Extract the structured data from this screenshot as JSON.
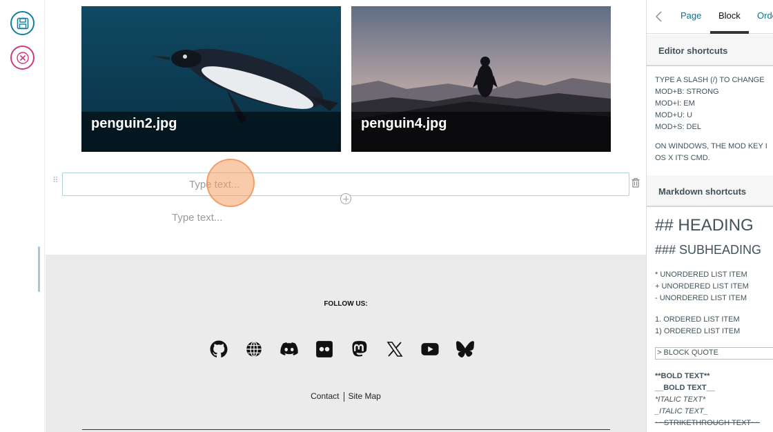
{
  "toolbar": {
    "save_icon": "save-icon",
    "cancel_icon": "close-icon"
  },
  "editor": {
    "images": [
      {
        "caption": "penguin2.jpg"
      },
      {
        "caption": "penguin4.jpg"
      }
    ],
    "text_block_placeholder": "Type text...",
    "next_block_placeholder": "Type text..."
  },
  "footer": {
    "follow_label": "FOLLOW US:",
    "socials": [
      "github-icon",
      "globe-icon",
      "discord-icon",
      "flickr-icon",
      "mastodon-icon",
      "x-icon",
      "youtube-icon",
      "bluesky-icon"
    ],
    "links": {
      "contact": "Contact",
      "sitemap": "Site Map"
    }
  },
  "sidebar": {
    "tabs": {
      "page": "Page",
      "block": "Block",
      "order": "Order"
    },
    "editor_shortcuts": {
      "title": "Editor shortcuts",
      "items": [
        "TYPE A SLASH (/) TO CHANGE",
        "MOD+B: STRONG",
        "MOD+I: EM",
        "MOD+U: U",
        "MOD+S: DEL"
      ],
      "note": [
        "ON WINDOWS, THE MOD KEY I",
        "OS X IT'S CMD."
      ]
    },
    "markdown_shortcuts": {
      "title": "Markdown shortcuts",
      "heading": "## HEADING",
      "subheading": "### SUBHEADING",
      "unordered": [
        "* UNORDERED LIST ITEM",
        "+ UNORDERED LIST ITEM",
        "- UNORDERED LIST ITEM"
      ],
      "ordered": [
        "1. ORDERED LIST ITEM",
        "1) ORDERED LIST ITEM"
      ],
      "quote": "> BLOCK QUOTE",
      "bold1": "**BOLD TEXT**",
      "bold2": "__BOLD TEXT__",
      "italic1": "*ITALIC TEXT*",
      "italic2": "_ITALIC TEXT_",
      "strike": "~~STRIKETHROUGH TEXT~~"
    }
  }
}
